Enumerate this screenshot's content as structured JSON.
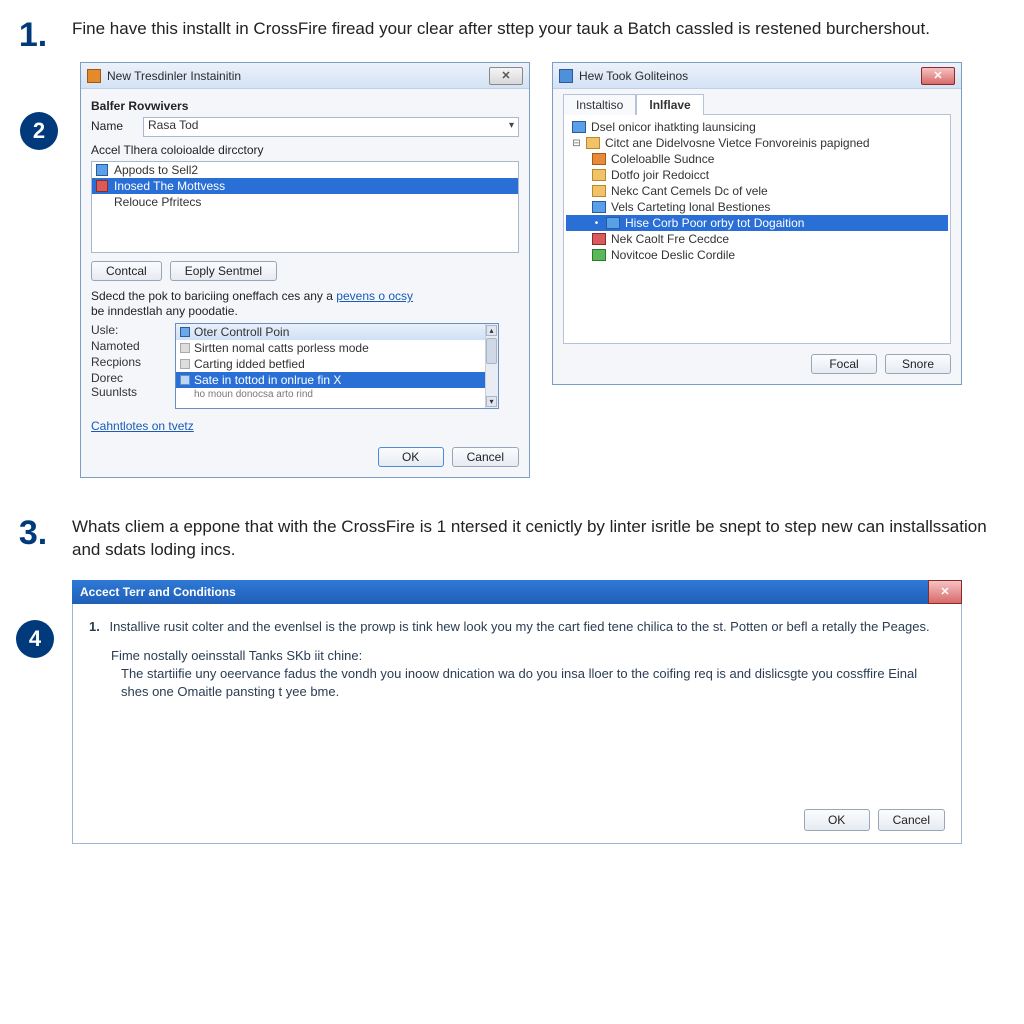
{
  "step1": {
    "number": "1.",
    "text": "Fine have this installt in CrossFire firead your clear after sttep your tauk a Batch cassled is restened burchershout."
  },
  "step2": {
    "number": "2"
  },
  "dialog1": {
    "title": "New Tresdinler Instainitin",
    "section": "Balfer Rovwivers",
    "name_label": "Name",
    "name_value": "Rasa Tod",
    "accel_label": "Accel Tlhera coloioalde dircctory",
    "list": [
      {
        "label": "Appods to Sell2"
      },
      {
        "label": "Inosed The Mottvess",
        "selected": true
      },
      {
        "label": "Relouce Pfritecs"
      }
    ],
    "btn_contcal": "Contcal",
    "btn_eoply": "Eoply Sentmel",
    "instruction": "Sdecd the pok to bariciing oneffach ces any a",
    "instruction_link": "pevens o ocsy",
    "instruction2": "be inndestlah any poodatie.",
    "rows": {
      "usle": "Usle:",
      "namoted": "Namoted",
      "recpions": "Recpions",
      "dorec": "Dorec Suunlsts"
    },
    "dropdown": [
      {
        "label": "Oter Controll Poin",
        "header": true
      },
      {
        "label": "Sirtten nomal catts porless mode"
      },
      {
        "label": "Carting idded betfied"
      },
      {
        "label": "Sate in tottod in onlrue fin X",
        "selected": true
      },
      {
        "label": "ho moun donocsa arto rind"
      }
    ],
    "footer_link": "Cahntlotes on tvetz",
    "ok": "OK",
    "cancel": "Cancel"
  },
  "dialog2": {
    "title": "Hew Took Goliteinos",
    "tab1": "Instaltiso",
    "tab2": "lnlflave",
    "tree": [
      {
        "lvl": 1,
        "icon": "blue",
        "label": "Dsel onicor ihatkting launsicing"
      },
      {
        "lvl": 1,
        "icon": "gray",
        "exp": "⊟",
        "folder": true,
        "label": "Citct ane Didelvosne Vietce Fonvoreinis papigned"
      },
      {
        "lvl": 2,
        "icon": "orange",
        "label": "Coleloablle Sudnce"
      },
      {
        "lvl": 2,
        "icon": "folder",
        "label": "Dotfo joir Redoicct"
      },
      {
        "lvl": 2,
        "icon": "folder",
        "label": "Nekc Cant Cemels Dc of vele"
      },
      {
        "lvl": 2,
        "icon": "blue",
        "label": "Vels Carteting lonal Bestiones"
      },
      {
        "lvl": 2,
        "icon": "blue",
        "label": "Hise Corb Poor orby tot Dogaition",
        "selected": true,
        "exp": "•"
      },
      {
        "lvl": 2,
        "icon": "red",
        "label": "Nek Caolt Fre Cecdce"
      },
      {
        "lvl": 2,
        "icon": "green",
        "label": "Novitcoe Deslic Cordile"
      }
    ],
    "btn_focal": "Focal",
    "btn_snare": "Snore"
  },
  "step3": {
    "number": "3.",
    "text": "Whats cliem a eppone that with the CrossFire is 1 ntersed it cenictly by linter isritle be snept to step new can installssation and sdats loding incs."
  },
  "step4": {
    "number": "4"
  },
  "dialog3": {
    "title": "Accect Terr and Conditions",
    "item_num": "1.",
    "para1": "Installive rusit colter and the evenlsel is the prowp is tink hew look you my the cart fied tene chilica to the st. Potten or befl a retally the Peages.",
    "para2a": "Fime nostally oeinsstall Tanks SKb iit chine:",
    "para2b": "The startiifie uny oeervance fadus the vondh you inoow dnication wa do you insa lloer to the coifing req is and dislicsgte you cossffire Einal shes one Omaitle pansting t yee bme.",
    "ok": "OK",
    "cancel": "Cancel"
  }
}
